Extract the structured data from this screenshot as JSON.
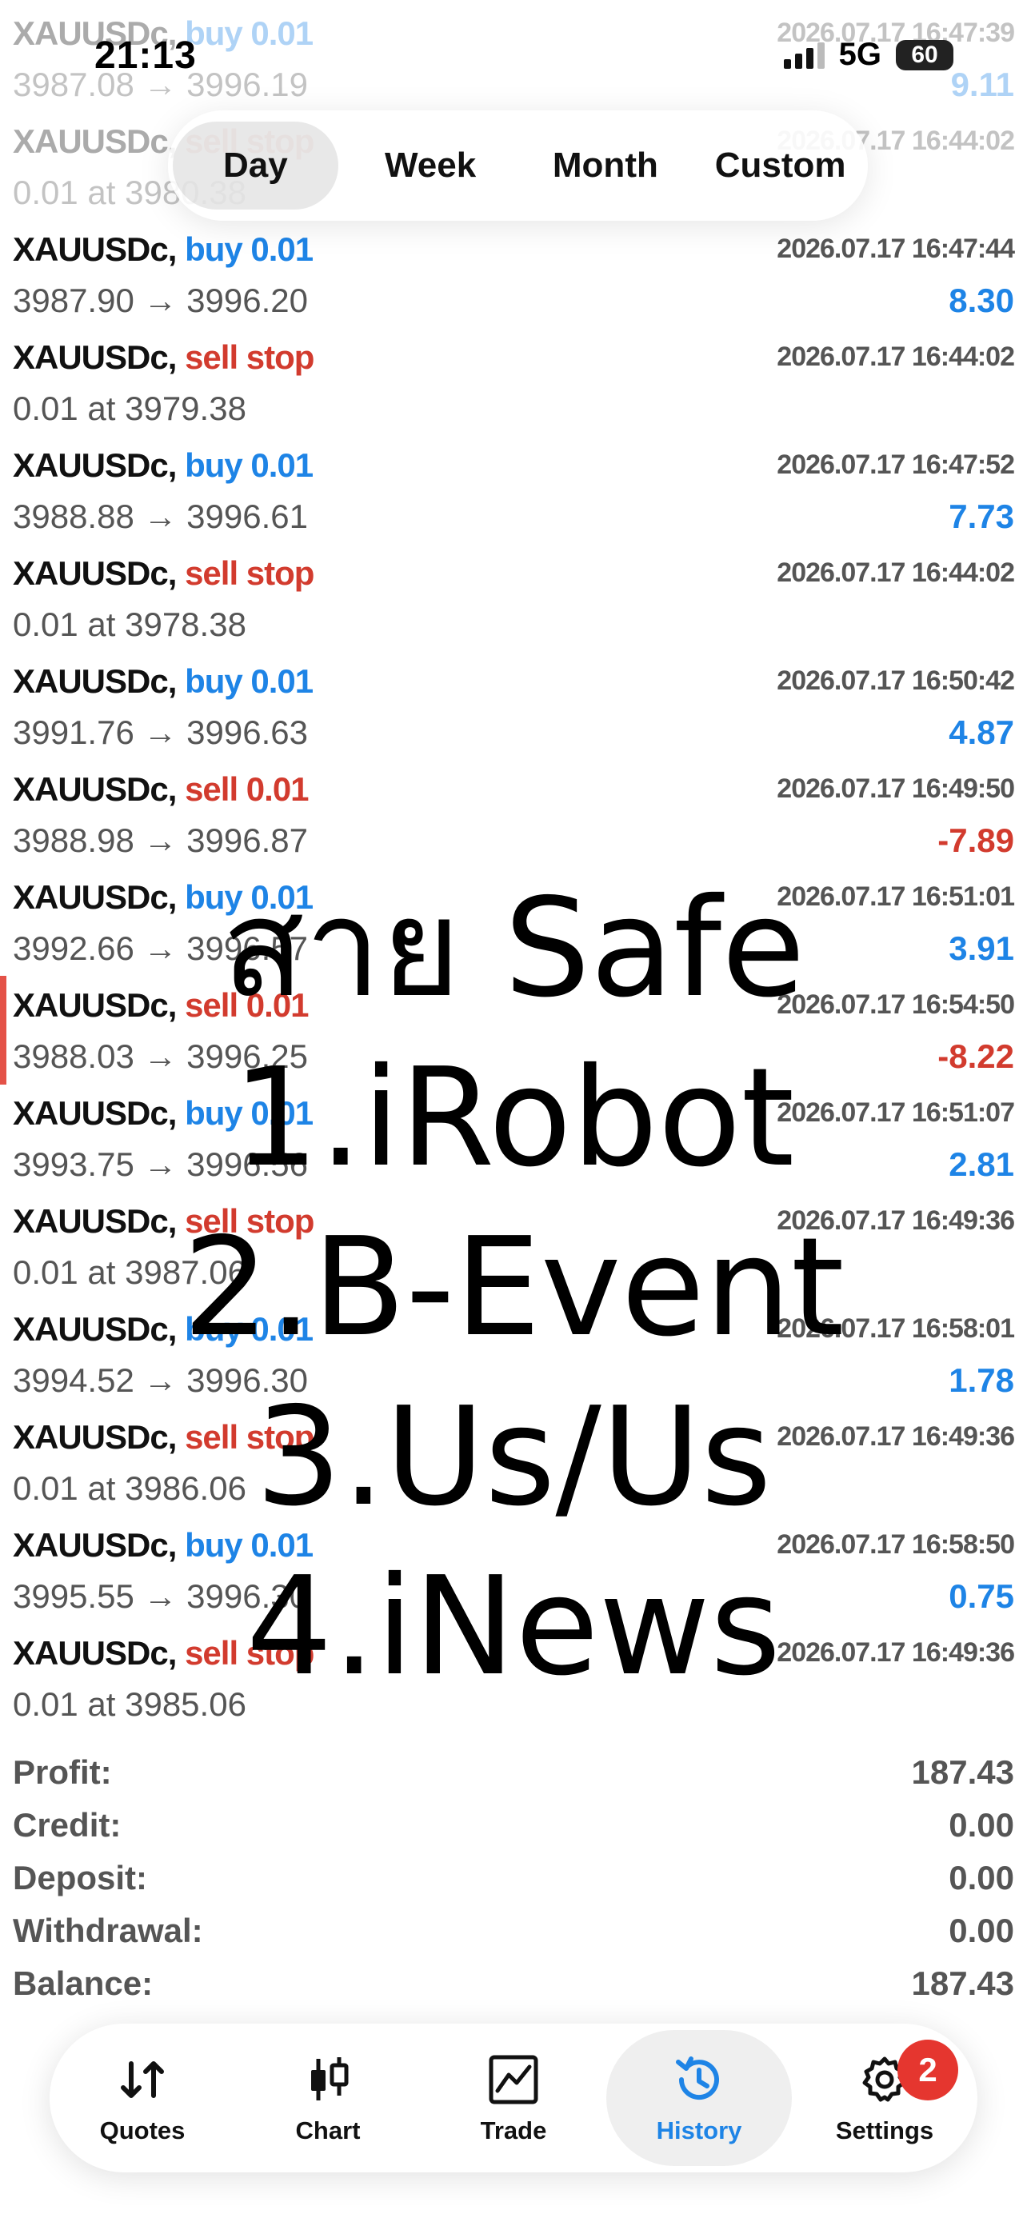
{
  "status_bar": {
    "time": "21:13",
    "network": "5G",
    "battery": "60"
  },
  "period_tabs": [
    {
      "label": "Day",
      "active": true
    },
    {
      "label": "Week",
      "active": false
    },
    {
      "label": "Month",
      "active": false
    },
    {
      "label": "Custom",
      "active": false
    }
  ],
  "orders": [
    {
      "symbol": "XAUUSDc,",
      "action": "buy 0.01",
      "side": "buy",
      "time": "2026.07.17 16:47:39",
      "detail": "3987.08 → 3996.19",
      "profit": "9.11"
    },
    {
      "symbol": "XAUUSDc,",
      "action": "sell stop",
      "side": "sell",
      "time": "2026.07.17 16:44:02",
      "detail": "0.01 at 3980.38",
      "profit": ""
    },
    {
      "symbol": "XAUUSDc,",
      "action": "buy 0.01",
      "side": "buy",
      "time": "2026.07.17 16:47:44",
      "detail": "3987.90 → 3996.20",
      "profit": "8.30"
    },
    {
      "symbol": "XAUUSDc,",
      "action": "sell stop",
      "side": "sell",
      "time": "2026.07.17 16:44:02",
      "detail": "0.01 at 3979.38",
      "profit": ""
    },
    {
      "symbol": "XAUUSDc,",
      "action": "buy 0.01",
      "side": "buy",
      "time": "2026.07.17 16:47:52",
      "detail": "3988.88 → 3996.61",
      "profit": "7.73"
    },
    {
      "symbol": "XAUUSDc,",
      "action": "sell stop",
      "side": "sell",
      "time": "2026.07.17 16:44:02",
      "detail": "0.01 at 3978.38",
      "profit": ""
    },
    {
      "symbol": "XAUUSDc,",
      "action": "buy 0.01",
      "side": "buy",
      "time": "2026.07.17 16:50:42",
      "detail": "3991.76 → 3996.63",
      "profit": "4.87"
    },
    {
      "symbol": "XAUUSDc,",
      "action": "sell 0.01",
      "side": "sell",
      "time": "2026.07.17 16:49:50",
      "detail": "3988.98 → 3996.87",
      "profit": "-7.89"
    },
    {
      "symbol": "XAUUSDc,",
      "action": "buy 0.01",
      "side": "buy",
      "time": "2026.07.17 16:51:01",
      "detail": "3992.66 → 3996.57",
      "profit": "3.91"
    },
    {
      "symbol": "XAUUSDc,",
      "action": "sell 0.01",
      "side": "sell",
      "time": "2026.07.17 16:54:50",
      "detail": "3988.03 → 3996.25",
      "profit": "-8.22"
    },
    {
      "symbol": "XAUUSDc,",
      "action": "buy 0.01",
      "side": "buy",
      "time": "2026.07.17 16:51:07",
      "detail": "3993.75 → 3996.56",
      "profit": "2.81"
    },
    {
      "symbol": "XAUUSDc,",
      "action": "sell stop",
      "side": "sell",
      "time": "2026.07.17 16:49:36",
      "detail": "0.01 at 3987.06",
      "profit": ""
    },
    {
      "symbol": "XAUUSDc,",
      "action": "buy 0.01",
      "side": "buy",
      "time": "2026.07.17 16:58:01",
      "detail": "3994.52 → 3996.30",
      "profit": "1.78"
    },
    {
      "symbol": "XAUUSDc,",
      "action": "sell stop",
      "side": "sell",
      "time": "2026.07.17 16:49:36",
      "detail": "0.01 at 3986.06",
      "profit": ""
    },
    {
      "symbol": "XAUUSDc,",
      "action": "buy 0.01",
      "side": "buy",
      "time": "2026.07.17 16:58:50",
      "detail": "3995.55 → 3996.30",
      "profit": "0.75"
    },
    {
      "symbol": "XAUUSDc,",
      "action": "sell stop",
      "side": "sell",
      "time": "2026.07.17 16:49:36",
      "detail": "0.01 at 3985.06",
      "profit": ""
    }
  ],
  "summary": [
    {
      "label": "Profit:",
      "value": "187.43"
    },
    {
      "label": "Credit:",
      "value": "0.00"
    },
    {
      "label": "Deposit:",
      "value": "0.00"
    },
    {
      "label": "Withdrawal:",
      "value": "0.00"
    },
    {
      "label": "Balance:",
      "value": "187.43"
    }
  ],
  "overlay_lines": [
    "สาย Safe",
    "1.iRobot",
    "2.B-Event",
    "3.Us/Us",
    "4.iNews"
  ],
  "tab_bar": [
    {
      "label": "Quotes",
      "icon": "arrows-up-down-icon",
      "active": false
    },
    {
      "label": "Chart",
      "icon": "candlestick-icon",
      "active": false
    },
    {
      "label": "Trade",
      "icon": "trade-chart-icon",
      "active": false
    },
    {
      "label": "History",
      "icon": "history-clock-icon",
      "active": true
    },
    {
      "label": "Settings",
      "icon": "gear-icon",
      "active": false,
      "badge": "2"
    }
  ],
  "colors": {
    "buy": "#1e84e6",
    "sell": "#d23b2e",
    "active_tab": "#1e84e6",
    "badge": "#e5362f"
  }
}
